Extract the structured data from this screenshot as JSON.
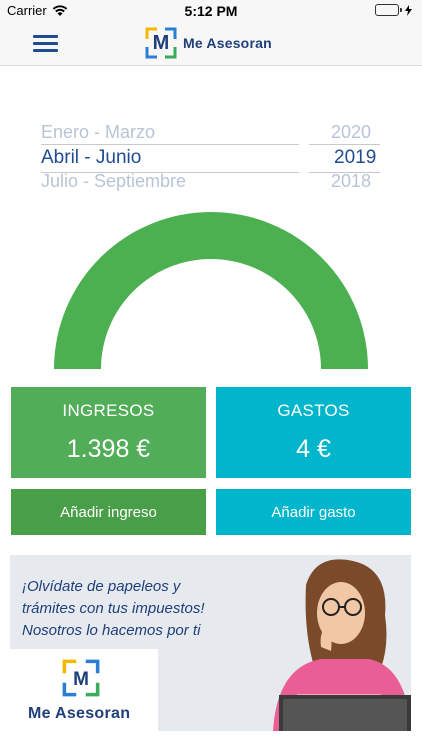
{
  "status_bar": {
    "carrier": "Carrier",
    "time": "5:12 PM",
    "battery_level": 1.0,
    "battery_color": "#4cd964"
  },
  "nav": {
    "menu_icon": "hamburger-icon",
    "logo_letter": "M",
    "logo_text": "Me Asesoran"
  },
  "picker": {
    "quarter_prev": "Enero - Marzo",
    "quarter_selected": "Abril - Junio",
    "quarter_next": "Julio - Septiembre",
    "year_prev": "2020",
    "year_selected": "2019",
    "year_next": "2018"
  },
  "gauge": {
    "color": "#4caf50",
    "fraction": 1.0
  },
  "ingresos": {
    "title": "INGRESOS",
    "value": "1.398 €",
    "add_label": "Añadir ingreso",
    "color": "#52ad58",
    "button_color": "#489f47"
  },
  "gastos": {
    "title": "GASTOS",
    "value": "4 €",
    "add_label": "Añadir gasto",
    "color": "#00b5cc",
    "button_color": "#00b5cc"
  },
  "banner": {
    "line1": "¡Olvídate de papeleos y",
    "line2": "trámites con tus impuestos!",
    "line3": "Nosotros lo hacemos por ti",
    "logo_letter": "M",
    "logo_text": "Me Asesoran"
  },
  "brand_colors": {
    "navy": "#1f3f7a",
    "logo_yellow": "#f5b800",
    "logo_green": "#3aaa5c",
    "logo_blue": "#2a7fd4"
  }
}
